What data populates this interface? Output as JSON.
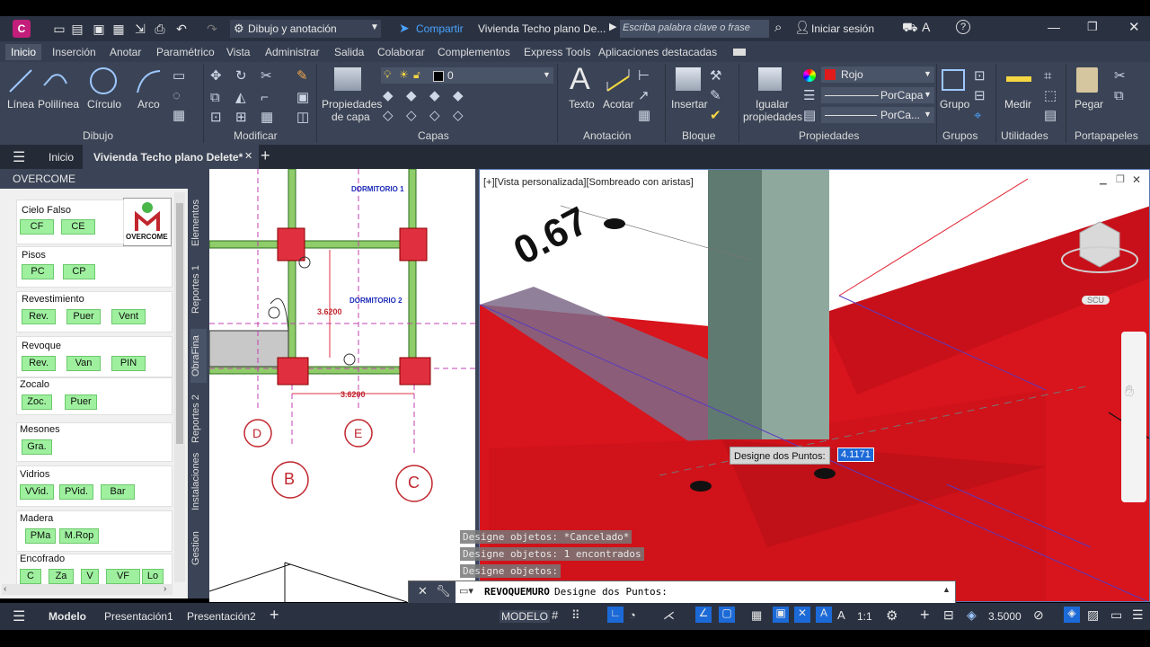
{
  "titlebar": {
    "app_letter": "C",
    "workspace": "Dibujo y anotación",
    "share": "Compartir",
    "doc_title": "Vivienda Techo plano De...",
    "search_placeholder": "Escriba palabra clave o frase",
    "signin": "Iniciar sesión"
  },
  "menu": {
    "tabs": [
      "Inicio",
      "Inserción",
      "Anotar",
      "Paramétrico",
      "Vista",
      "Administrar",
      "Salida",
      "Colaborar",
      "Complementos",
      "Express Tools",
      "Aplicaciones destacadas"
    ]
  },
  "ribbon": {
    "draw": {
      "linea": "Línea",
      "polilinea": "Polilínea",
      "circulo": "Círculo",
      "arco": "Arco",
      "title": "Dibujo"
    },
    "modify": {
      "title": "Modificar"
    },
    "layers": {
      "props": "Propiedades",
      "props2": "de capa",
      "current_layer": "0",
      "title": "Capas"
    },
    "annotation": {
      "texto": "Texto",
      "acotar": "Acotar",
      "title": "Anotación"
    },
    "block": {
      "insertar": "Insertar",
      "title": "Bloque"
    },
    "properties": {
      "igualar": "Igualar",
      "igualar2": "propiedades",
      "color": "Rojo",
      "linetype": "PorCapa",
      "lineweight": "PorCa...",
      "title": "Propiedades"
    },
    "groups": {
      "grupo": "Grupo",
      "title": "Grupos"
    },
    "utilities": {
      "medir": "Medir",
      "title": "Utilidades"
    },
    "clipboard": {
      "pegar": "Pegar",
      "title": "Portapapeles"
    }
  },
  "doctabs": {
    "home": "Inicio",
    "active": "Vivienda Techo plano Delete*"
  },
  "palette": {
    "title": "OVERCOME",
    "logo_text": "OVERCOME",
    "groups": [
      {
        "title": "Cielo Falso",
        "buttons": [
          "CF",
          "CE"
        ]
      },
      {
        "title": "Pisos",
        "buttons": [
          "PC",
          "CP"
        ]
      },
      {
        "title": "Revestimiento",
        "buttons": [
          "Rev.",
          "Puer",
          "Vent"
        ]
      },
      {
        "title": "Revoque",
        "buttons": [
          "Rev.",
          "Van",
          "PIN"
        ]
      },
      {
        "title": "Zocalo",
        "buttons": [
          "Zoc.",
          "Puer"
        ]
      },
      {
        "title": "Mesones",
        "buttons": [
          "Gra."
        ]
      },
      {
        "title": "Vidrios",
        "buttons": [
          "VVid.",
          "PVid.",
          "Bar"
        ]
      },
      {
        "title": "Madera",
        "buttons": [
          "PMa",
          "M.Rop"
        ]
      },
      {
        "title": "Encofrado",
        "buttons": [
          "C",
          "Za",
          "V",
          "VF",
          "Lo"
        ]
      }
    ],
    "vtabs": [
      "Elementos",
      "Reportes 1",
      "ObraFina",
      "Reportes 2",
      "Instalaciones",
      "Gestion"
    ]
  },
  "drawing2d": {
    "room1": "DORMITORIO 1",
    "room2": "DORMITORIO 2",
    "dim1": "3.6200",
    "dim2": "3.6200",
    "axis_labels": [
      "D",
      "E",
      "B",
      "C"
    ]
  },
  "view3d": {
    "viewport_label": "[+][Vista personalizada][Sombreado con aristas]",
    "dim_text": "0.67",
    "prompt_label": "Designe dos Puntos:",
    "prompt_value": "4.1171",
    "viewcube_label": "SCU"
  },
  "command": {
    "history": [
      "Designe objetos: *Cancelado*",
      "Designe objetos: 1 encontrados",
      "Designe objetos:"
    ],
    "current_cmd": "REVOQUEMURO",
    "current_prompt": "Designe dos Puntos:"
  },
  "statusbar": {
    "tabs": [
      "Modelo",
      "Presentación1",
      "Presentación2"
    ],
    "space": "MODELO",
    "scale": "1:1",
    "value": "3.5000"
  },
  "colors": {
    "accent": "#c0262e",
    "palette_btn": "#9ef09e",
    "ribbon_bg": "#3b4456"
  }
}
